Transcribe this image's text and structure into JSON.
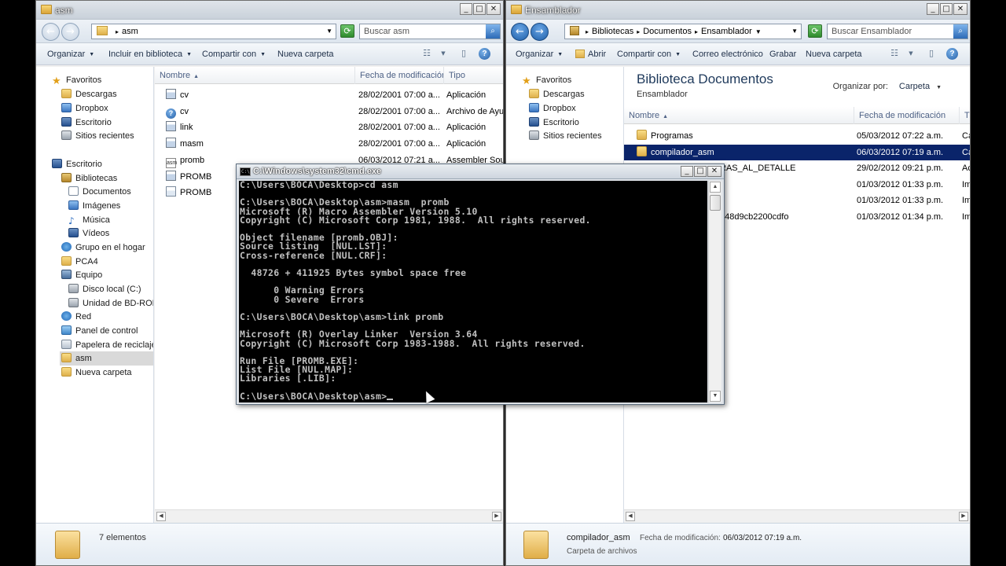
{
  "left_window": {
    "title": "asm",
    "address": [
      "asm"
    ],
    "search_placeholder": "Buscar asm",
    "toolbar": [
      "Organizar",
      "Incluir en biblioteca",
      "Compartir con",
      "Nueva carpeta"
    ],
    "nav": [
      "Favoritos",
      "Descargas",
      "Dropbox",
      "Escritorio",
      "Sitios recientes",
      "Escritorio",
      "Bibliotecas",
      "Documentos",
      "Imágenes",
      "Música",
      "Vídeos",
      "Grupo en el hogar",
      "PCA4",
      "Equipo",
      "Disco local (C:)",
      "Unidad de BD-ROM (",
      "Red",
      "Panel de control",
      "Papelera de reciclaje",
      "asm",
      "Nueva carpeta"
    ],
    "columns": [
      "Nombre",
      "Fecha de modificación",
      "Tipo"
    ],
    "files": [
      {
        "name": "cv",
        "date": "28/02/2001 07:00 a...",
        "type": "Aplicación",
        "icon": "app-icon"
      },
      {
        "name": "cv",
        "date": "28/02/2001 07:00 a...",
        "type": "Archivo de Ayuda",
        "icon": "help-file-icon"
      },
      {
        "name": "link",
        "date": "28/02/2001 07:00 a...",
        "type": "Aplicación",
        "icon": "app-icon"
      },
      {
        "name": "masm",
        "date": "28/02/2001 07:00 a...",
        "type": "Aplicación",
        "icon": "app-icon"
      },
      {
        "name": "promb",
        "date": "06/03/2012 07:21 a...",
        "type": "Assembler Source",
        "icon": "asm-file-icon"
      },
      {
        "name": "PROMB",
        "date": "",
        "type": "",
        "icon": "app-icon"
      },
      {
        "name": "PROMB",
        "date": "",
        "type": "",
        "icon": "doc-icon"
      }
    ],
    "status": "7 elementos"
  },
  "right_window": {
    "title": "Ensamblador",
    "address": [
      "Bibliotecas",
      "Documentos",
      "Ensamblador"
    ],
    "search_placeholder": "Buscar Ensamblador",
    "toolbar": [
      "Organizar",
      "Abrir",
      "Compartir con",
      "Correo electrónico",
      "Grabar",
      "Nueva carpeta"
    ],
    "nav": [
      "Favoritos",
      "Descargas",
      "Dropbox",
      "Escritorio",
      "Sitios recientes"
    ],
    "library_title": "Biblioteca Documentos",
    "library_sub": "Ensamblador",
    "arrange_label": "Organizar por:",
    "arrange_value": "Carpeta",
    "columns": [
      "Nombre",
      "Fecha de modificación",
      "Tip"
    ],
    "files": [
      {
        "name": "Programas",
        "date": "05/03/2012 07:22 a.m.",
        "type": "Ca"
      },
      {
        "name": "compilador_asm",
        "date": "06/03/2012 07:19 a.m.",
        "type": "Ca"
      },
      {
        "name": "RAS_AL_DETALLE",
        "date": "29/02/2012 09:21 p.m.",
        "type": "Ac"
      },
      {
        "name": "",
        "date": "01/03/2012 01:33 p.m.",
        "type": "Im"
      },
      {
        "name": "",
        "date": "01/03/2012 01:33 p.m.",
        "type": "Im"
      },
      {
        "name": "548d9cb2200cdfo",
        "date": "01/03/2012 01:34 p.m.",
        "type": "Im"
      }
    ],
    "detail_name": "compilador_asm",
    "detail_mod_label": "Fecha de modificación:",
    "detail_mod_value": "06/03/2012 07:19 a.m.",
    "detail_type": "Carpeta de archivos"
  },
  "cmd": {
    "title": "C:\\Windows\\system32\\cmd.exe",
    "lines": [
      "C:\\Users\\BOCA\\Desktop>cd asm",
      "",
      "C:\\Users\\BOCA\\Desktop\\asm>masm  promb",
      "Microsoft (R) Macro Assembler Version 5.10",
      "Copyright (C) Microsoft Corp 1981, 1988.  All rights reserved.",
      "",
      "Object filename [promb.OBJ]:",
      "Source listing  [NUL.LST]:",
      "Cross-reference [NUL.CRF]:",
      "",
      "  48726 + 411925 Bytes symbol space free",
      "",
      "      0 Warning Errors",
      "      0 Severe  Errors",
      "",
      "C:\\Users\\BOCA\\Desktop\\asm>link promb",
      "",
      "Microsoft (R) Overlay Linker  Version 3.64",
      "Copyright (C) Microsoft Corp 1983-1988.  All rights reserved.",
      "",
      "Run File [PROMB.EXE]:",
      "List File [NUL.MAP]:",
      "Libraries [.LIB]:",
      ""
    ],
    "prompt": "C:\\Users\\BOCA\\Desktop\\asm>"
  }
}
